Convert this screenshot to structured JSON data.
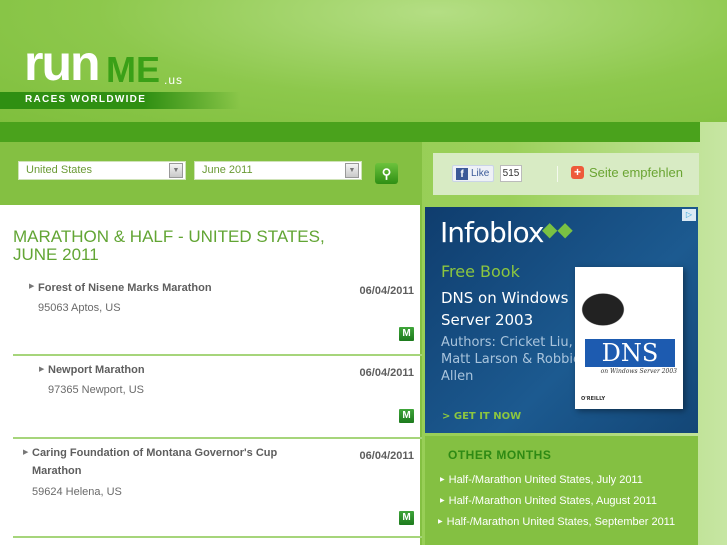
{
  "header": {
    "logo_run": "run",
    "logo_me": "ME",
    "logo_tld": ".us",
    "tagline": "RACES WORLDWIDE"
  },
  "filter": {
    "country": "United States",
    "month": "June 2011",
    "search_icon": "search-icon"
  },
  "social": {
    "like_label": "Like",
    "like_count": "515",
    "recommend_label": "Seite empfehlen"
  },
  "main": {
    "title": "MARATHON & HALF - UNITED STATES, JUNE 2011",
    "races": [
      {
        "name": "Forest of Nisene Marks Marathon",
        "location": "95063 Aptos, US",
        "date": "06/04/2011",
        "badge": "M"
      },
      {
        "name": "Newport Marathon",
        "location": "97365 Newport, US",
        "date": "06/04/2011",
        "badge": "M"
      },
      {
        "name": "Caring Foundation of Montana Governor's Cup Marathon",
        "location": "59624 Helena, US",
        "date": "06/04/2011",
        "badge": "M"
      }
    ]
  },
  "ad": {
    "brand": "Infoblox",
    "headline": "Free Book",
    "title": "DNS on Windows Server 2003",
    "authors": "Authors: Cricket Liu, Matt Larson & Robbie Allen",
    "cta": "> GET IT NOW",
    "book_title": "DNS",
    "book_subtitle": "on Windows Server 2003",
    "publisher": "O'REILLY"
  },
  "other_months": {
    "heading": "OTHER MONTHS",
    "links": [
      "Half-/Marathon United States, July 2011",
      "Half-/Marathon United States, August 2011",
      "Half-/Marathon United States, September 2011"
    ]
  }
}
